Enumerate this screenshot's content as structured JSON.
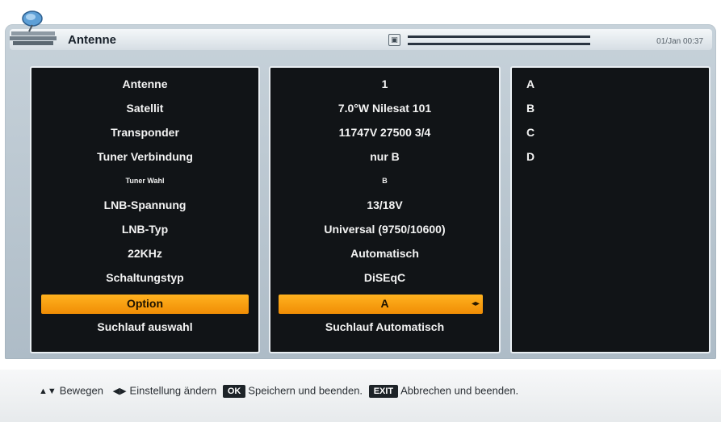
{
  "window": {
    "title": "Antenne",
    "datetime": "01/Jan 00:37"
  },
  "status": {
    "signal_icon": "signal-icon"
  },
  "settings": [
    {
      "label": "Antenne",
      "value": "1"
    },
    {
      "label": "Satellit",
      "value": "7.0°W Nilesat 101"
    },
    {
      "label": "Transponder",
      "value": "11747V 27500 3/4"
    },
    {
      "label": "Tuner Verbindung",
      "value": "nur B"
    },
    {
      "label": "Tuner Wahl",
      "value": "B"
    },
    {
      "label": "LNB-Spannung",
      "value": "13/18V"
    },
    {
      "label": "LNB-Typ",
      "value": "Universal (9750/10600)"
    },
    {
      "label": "22KHz",
      "value": "Automatisch"
    },
    {
      "label": "Schaltungstyp",
      "value": "DiSEqC"
    },
    {
      "label": "Option",
      "value": "A"
    },
    {
      "label": "Suchlauf auswahl",
      "value": "Suchlauf Automatisch"
    }
  ],
  "selected_index": 9,
  "options": [
    "A",
    "B",
    "C",
    "D"
  ],
  "footer": {
    "move_label": "Bewegen",
    "change_label": "Einstellung ändern",
    "ok_key": "OK",
    "ok_label": "Speichern und beenden.",
    "exit_key": "EXIT",
    "exit_label": "Abbrechen und beenden."
  }
}
